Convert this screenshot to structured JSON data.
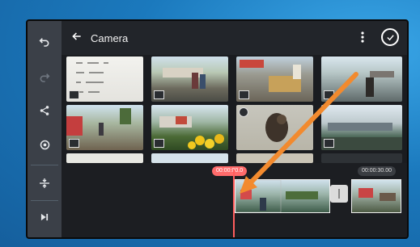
{
  "header": {
    "title": "Camera"
  },
  "timeline": {
    "current_time": "00:00:00.0",
    "end_time": "00:00:30.00"
  },
  "icons": {
    "undo": "undo-icon",
    "redo": "redo-icon",
    "share": "share-icon",
    "settings": "settings-icon",
    "split": "split-icon",
    "skip": "skip-to-end-icon",
    "back": "back-arrow-icon",
    "more": "more-vertical-icon",
    "done": "checkmark-circle-icon"
  },
  "colors": {
    "accent": "#ff6b6b",
    "annotation_arrow": "#f28a2e",
    "rail": "#3b4048"
  }
}
